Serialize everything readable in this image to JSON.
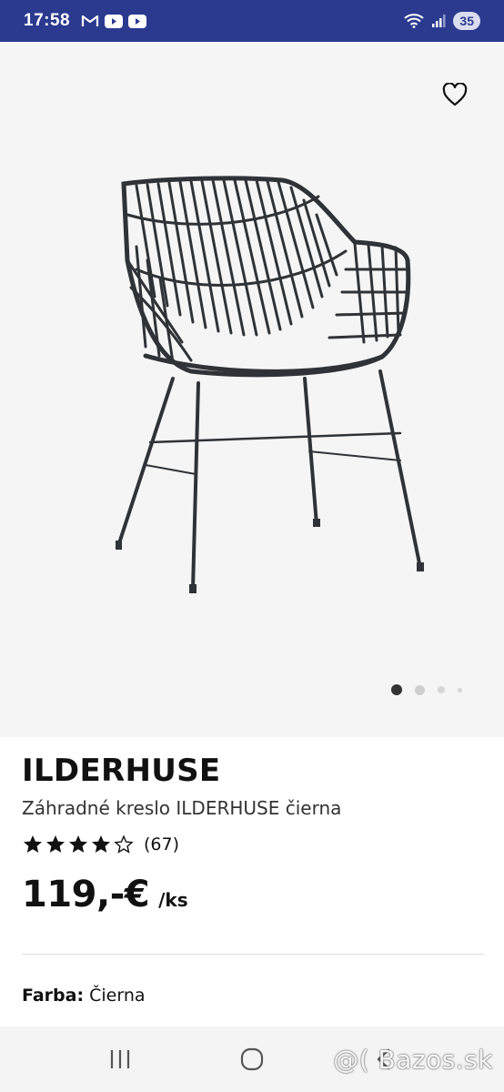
{
  "status_bar": {
    "time": "17:58",
    "left_icons": [
      "gmail-icon",
      "youtube-icon",
      "youtube-icon"
    ],
    "right_icons": [
      "wifi-icon",
      "signal-icon"
    ],
    "battery": "35",
    "background": "#2b3a8f"
  },
  "product": {
    "name": "ILDERHUSE",
    "description": "Záhradné kreslo ILDERHUSE čierna",
    "rating": 4,
    "rating_max": 5,
    "rating_count": "(67)",
    "price": "119,-€",
    "unit": "/ks",
    "color_label": "Farba:",
    "color_value": "Čierna"
  },
  "carousel": {
    "total": 4,
    "active": 1
  },
  "nav": {
    "buttons": [
      "recent-apps-icon",
      "home-icon",
      "back-icon"
    ]
  },
  "watermark": "@( Bazos.sk"
}
